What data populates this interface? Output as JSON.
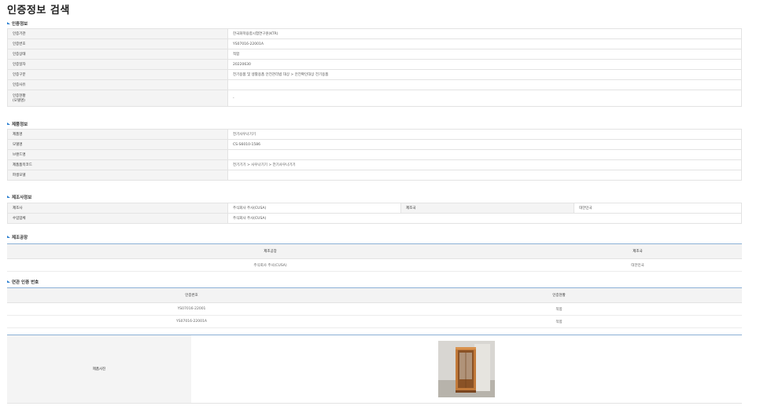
{
  "page_title": "인증정보 검색",
  "sections": {
    "cert": "인증정보",
    "product": "제품정보",
    "maker": "제조사정보",
    "factory": "제조공장",
    "related": "연관 인증 번호"
  },
  "cert_info": {
    "rows": [
      {
        "label": "인증기관",
        "value": "한국화학융합시험연구원(KTR)"
      },
      {
        "label": "인증번호",
        "value": "YS07016-22001A"
      },
      {
        "label": "인증상태",
        "value": "적합"
      },
      {
        "label": "인증일자",
        "value": "20220630"
      },
      {
        "label": "인증구분",
        "value": "전기용품 및 생활용품 안전관리법 대상 > 안전확인대상 전기용품"
      },
      {
        "label": "인증사유",
        "value": ""
      },
      {
        "label": "인증현황",
        "label2": "(모델명)",
        "value": "-"
      }
    ]
  },
  "product_info": {
    "rows": [
      {
        "label": "제품명",
        "value": "전기사우나기기"
      },
      {
        "label": "모델명",
        "value": "CS-S6010-1586"
      },
      {
        "label": "브랜드명",
        "value": ""
      },
      {
        "label": "제품품목코드",
        "value": "전기기기 > 사우나기기 > 전기사우나기기"
      },
      {
        "label": "파생모델",
        "value": ""
      }
    ]
  },
  "maker_info": {
    "maker_label": "제조사",
    "maker_value": "주식회사 주사(CUSA)",
    "country_label": "제조국",
    "country_value": "대한민국",
    "importer_label": "수입업체",
    "importer_value": "주식회사 주사(CUSA)"
  },
  "factory": {
    "headers": [
      "제조공장",
      "제조국"
    ],
    "rows": [
      [
        "주식회사 주사(CUSA)",
        "대한민국"
      ]
    ]
  },
  "related": {
    "headers": [
      "인증번호",
      "인증현황"
    ],
    "rows": [
      [
        "YS07016-22001",
        "적합"
      ],
      [
        "YS07016-22001A",
        "적합"
      ]
    ]
  },
  "photo": {
    "label": "제품사진"
  }
}
